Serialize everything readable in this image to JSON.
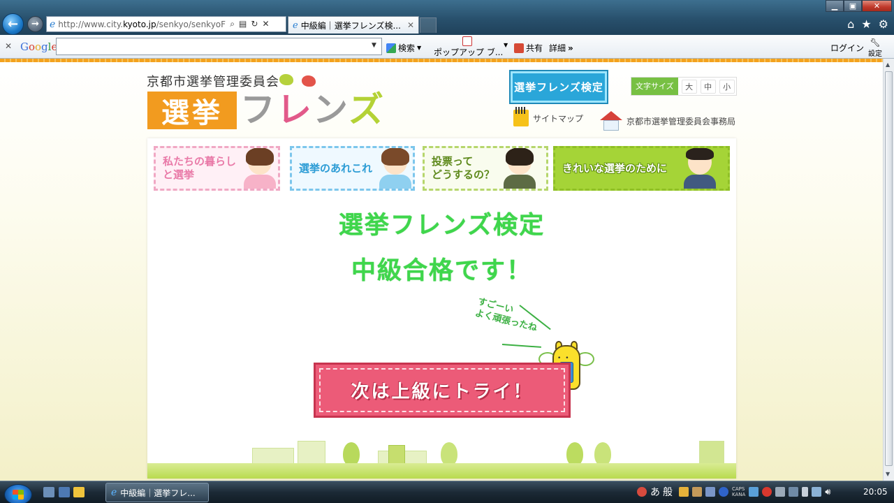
{
  "browser": {
    "address": {
      "url_prefix": "http://www.city.",
      "url_domain": "kyoto.jp",
      "url_suffix": "/senkyo/senkyoFri"
    },
    "tab": {
      "title": "中級編｜選挙フレンズ検..."
    },
    "google_bar": {
      "logo": [
        "G",
        "o",
        "o",
        "g",
        "l",
        "e"
      ],
      "search_value": "",
      "search_label": "検索",
      "popup_label": "ポップアップ ブ...",
      "share_label": "共有",
      "detail_label": "詳細",
      "login_label": "ログイン",
      "settings_label": "設定"
    }
  },
  "header": {
    "org_name": "京都市選挙管理委員会",
    "logo_senkyo": "選挙",
    "logo_friends": [
      "フ",
      "レ",
      "ン",
      "ズ"
    ],
    "kentei_button": "選挙フレンズ検定",
    "font_size": {
      "label": "文字サイズ",
      "large": "大",
      "medium": "中",
      "small": "小"
    },
    "sitemap_link": "サイトマップ",
    "office_link": "京都市選挙管理委員会事務局"
  },
  "nav_cards": [
    {
      "label": "私たちの暮らし\nと選挙"
    },
    {
      "label": "選挙のあれこれ"
    },
    {
      "label": "投票って\nどうするの？"
    },
    {
      "label": "きれいな選挙のために"
    }
  ],
  "result": {
    "line1": "選挙フレンズ検定",
    "line2": "中級合格です！",
    "speech": "すごーい\nよく頑張ったね",
    "next_button": "次は上級にトライ！"
  },
  "taskbar": {
    "task_title": "中級編｜選挙フレ...",
    "ime": "あ般",
    "caps": "CAPS",
    "kana": "KANA",
    "clock": "20:05"
  },
  "colors": {
    "accent_green": "#3fd64c",
    "brand_orange": "#f29b1f",
    "button_pink": "#ec5b78",
    "kentei_blue": "#2aa6d9"
  }
}
